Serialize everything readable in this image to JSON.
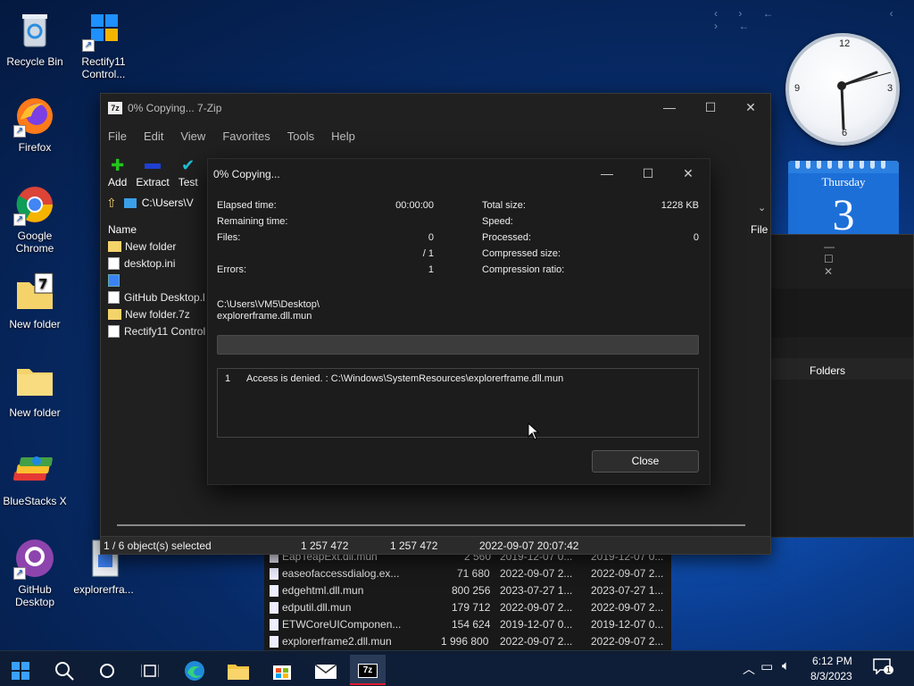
{
  "desktop": {
    "icons": [
      {
        "label": "Recycle Bin"
      },
      {
        "label": "Rectify11 Control..."
      },
      {
        "label": "Firefox"
      },
      {
        "label": "Google Chrome"
      },
      {
        "label": "New folder"
      },
      {
        "label": "New folder"
      },
      {
        "label": "BlueStacks X"
      },
      {
        "label": "GitHub Desktop"
      },
      {
        "label": "explorerfra..."
      }
    ]
  },
  "clock": {
    "numbers": [
      "12",
      "3",
      "6",
      "9"
    ]
  },
  "calendar": {
    "day": "Thursday",
    "date": "3"
  },
  "main_window": {
    "title": "0% Copying... 7-Zip",
    "menu": [
      "File",
      "Edit",
      "View",
      "Favorites",
      "Tools",
      "Help"
    ],
    "toolbar": [
      "Add",
      "Extract",
      "Test"
    ],
    "path": "C:\\Users\\V",
    "list_header": "Name",
    "file_column": "File",
    "files": [
      {
        "name": "New folder",
        "icon": "folder-icon"
      },
      {
        "name": "desktop.ini",
        "icon": "ini-file-icon"
      },
      {
        "name": "",
        "icon": "dll-file-icon"
      },
      {
        "name": "GitHub Desktop.l",
        "icon": "file-icon"
      },
      {
        "name": "New folder.7z",
        "icon": "7z-archive-icon"
      },
      {
        "name": "Rectify11 Control",
        "icon": "file-icon"
      }
    ],
    "status": {
      "selection": "1 / 6 object(s) selected",
      "size": "1 257 472",
      "packed": "1 257 472",
      "modified": "2022-09-07 20:07:42"
    }
  },
  "bg_window": {
    "folders_label": "Folders"
  },
  "dialog": {
    "title": "0% Copying...",
    "left_labels": [
      "Elapsed time:",
      "Remaining time:",
      "Files:",
      "",
      "Errors:"
    ],
    "left_values": [
      "00:00:00",
      "",
      "0",
      "/ 1",
      "1"
    ],
    "right_labels": [
      "Total size:",
      "Speed:",
      "Processed:",
      "Compressed size:",
      "Compression ratio:"
    ],
    "right_values": [
      "1228 KB",
      "",
      "0",
      "",
      ""
    ],
    "path_line1": "C:\\Users\\VM5\\Desktop\\",
    "path_line2": "explorerframe.dll.mun",
    "progress": 0,
    "error_index": "1",
    "error_text": "Access is denied. : C:\\Windows\\SystemResources\\explorerframe.dll.mun",
    "close_label": "Close"
  },
  "explorer_rows": [
    {
      "name": "EapTeapExt.dll.mun",
      "size": "2 560",
      "date1": "2019-12-07 0...",
      "date2": "2019-12-07 0..."
    },
    {
      "name": "easeofaccessdialog.ex...",
      "size": "71 680",
      "date1": "2022-09-07 2...",
      "date2": "2022-09-07 2..."
    },
    {
      "name": "edgehtml.dll.mun",
      "size": "800 256",
      "date1": "2023-07-27 1...",
      "date2": "2023-07-27 1..."
    },
    {
      "name": "edputil.dll.mun",
      "size": "179 712",
      "date1": "2022-09-07 2...",
      "date2": "2022-09-07 2..."
    },
    {
      "name": "ETWCoreUIComponen...",
      "size": "154 624",
      "date1": "2019-12-07 0...",
      "date2": "2019-12-07 0..."
    },
    {
      "name": "explorerframe2.dll.mun",
      "size": "1 996 800",
      "date1": "2022-09-07 2...",
      "date2": "2022-09-07 2..."
    }
  ],
  "taskbar": {
    "time": "6:12 PM",
    "date": "8/3/2023",
    "notification_count": "1"
  },
  "colors": {
    "accent": "#1d6fd8",
    "window_bg": "#202020",
    "dialog_bg": "#1c1c1c",
    "taskbar": "#0f1d33"
  }
}
